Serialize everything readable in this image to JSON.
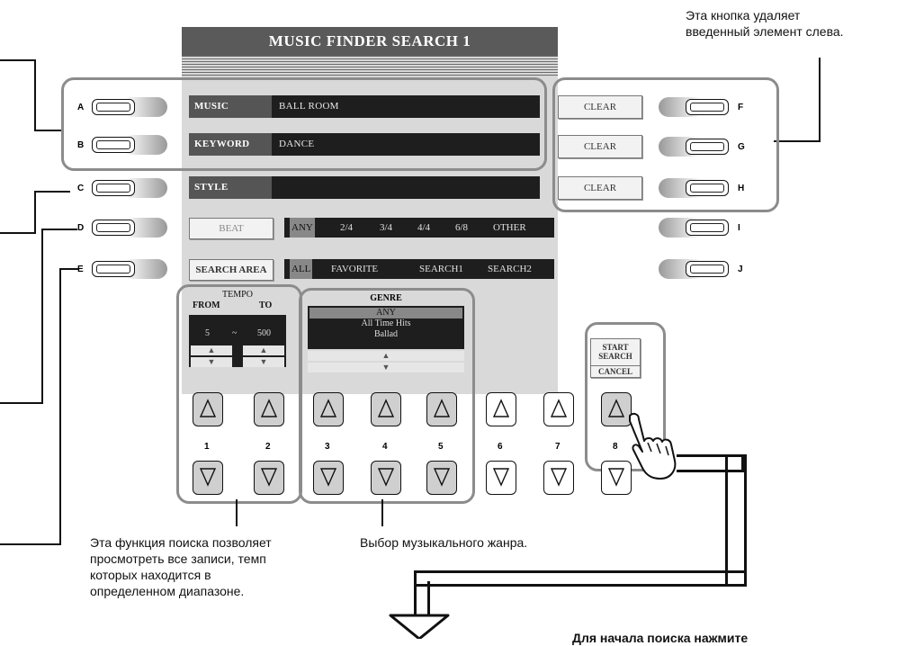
{
  "screen": {
    "title": "MUSIC FINDER SEARCH 1",
    "music": {
      "label": "MUSIC",
      "value": "BALL ROOM"
    },
    "keyword": {
      "label": "KEYWORD",
      "value": "DANCE"
    },
    "style": {
      "label": "STYLE",
      "value": ""
    },
    "clear_label": "CLEAR",
    "beat": {
      "label": "BEAT",
      "options": [
        "ANY",
        "2/4",
        "3/4",
        "4/4",
        "6/8",
        "OTHER"
      ],
      "selected": "ANY"
    },
    "search_area": {
      "label": "SEARCH AREA",
      "options": [
        "ALL",
        "FAVORITE",
        "SEARCH1",
        "SEARCH2"
      ],
      "selected": "ALL"
    },
    "tempo": {
      "label": "TEMPO",
      "from_label": "FROM",
      "to_label": "TO",
      "from_value": "5",
      "separator": "~",
      "to_value": "500"
    },
    "genre": {
      "label": "GENRE",
      "items": [
        "ANY",
        "All Time Hits",
        "Ballad"
      ],
      "selected": "ANY"
    },
    "start_search": {
      "line1": "START",
      "line2": "SEARCH",
      "cancel": "CANCEL"
    }
  },
  "side_buttons": {
    "left": [
      "A",
      "B",
      "C",
      "D",
      "E"
    ],
    "right": [
      "F",
      "G",
      "H",
      "I",
      "J"
    ]
  },
  "bottom_numbers": [
    "1",
    "2",
    "3",
    "4",
    "5",
    "6",
    "7",
    "8"
  ],
  "annotations": {
    "clear_note_line1": "Эта кнопка удаляет",
    "clear_note_line2": "введенный элемент слева.",
    "tempo_note_line1": "Эта функция поиска позволяет",
    "tempo_note_line2": "просмотреть все записи, темп",
    "tempo_note_line3": "которых находится в",
    "tempo_note_line4": "определенном диапазоне.",
    "genre_note": "Выбор музыкального жанра.",
    "start_note": "Для начала поиска нажмите"
  }
}
